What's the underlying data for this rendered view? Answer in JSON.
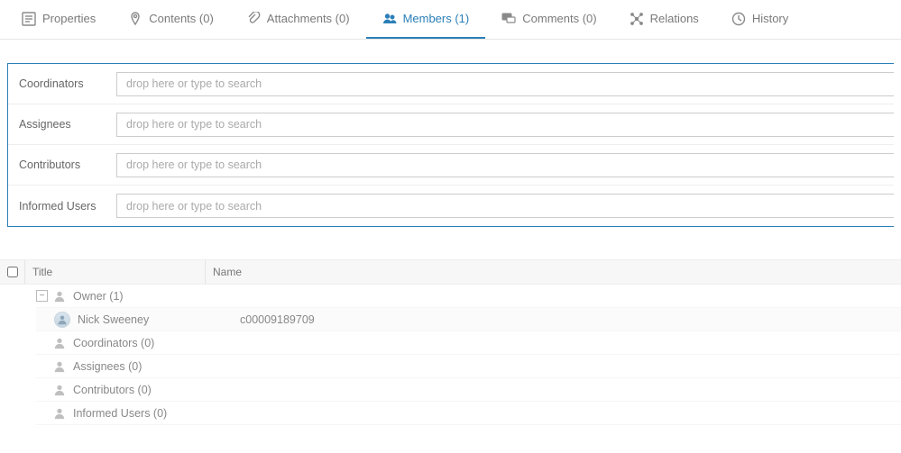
{
  "tabs": [
    {
      "label": "Properties",
      "icon": "properties",
      "active": false
    },
    {
      "label": "Contents (0)",
      "icon": "pin",
      "active": false
    },
    {
      "label": "Attachments (0)",
      "icon": "attachment",
      "active": false
    },
    {
      "label": "Members (1)",
      "icon": "members",
      "active": true
    },
    {
      "label": "Comments (0)",
      "icon": "comments",
      "active": false
    },
    {
      "label": "Relations",
      "icon": "relations",
      "active": false
    },
    {
      "label": "History",
      "icon": "history",
      "active": false
    }
  ],
  "form": {
    "placeholder": "drop here or type to search",
    "rows": [
      {
        "label": "Coordinators"
      },
      {
        "label": "Assignees"
      },
      {
        "label": "Contributors"
      },
      {
        "label": "Informed Users"
      }
    ]
  },
  "table": {
    "headers": {
      "title": "Title",
      "name": "Name"
    },
    "groups": [
      {
        "label": "Owner (1)",
        "expanded": true,
        "children": [
          {
            "title": "Nick Sweeney",
            "name": "c00009189709"
          }
        ]
      },
      {
        "label": "Coordinators (0)",
        "expanded": false,
        "children": []
      },
      {
        "label": "Assignees (0)",
        "expanded": false,
        "children": []
      },
      {
        "label": "Contributors (0)",
        "expanded": false,
        "children": []
      },
      {
        "label": "Informed Users (0)",
        "expanded": false,
        "children": []
      }
    ]
  }
}
